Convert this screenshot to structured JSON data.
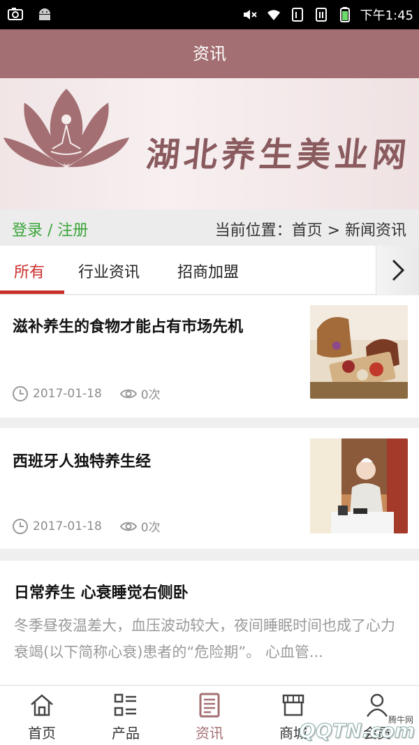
{
  "status_bar": {
    "time": "下午1:45",
    "icons": [
      "camera-icon",
      "android-icon",
      "mute-icon",
      "wifi-icon",
      "sim1-icon",
      "sim2-icon",
      "battery-icon"
    ]
  },
  "header": {
    "title": "资讯"
  },
  "banner": {
    "brand_text": "湖北养生美业网"
  },
  "breadcrumb": {
    "login_register": "登录 / 注册",
    "location": "当前位置：首页 > 新闻资讯"
  },
  "tabs": [
    {
      "label": "所有",
      "active": true
    },
    {
      "label": "行业资讯",
      "active": false
    },
    {
      "label": "招商加盟",
      "active": false
    }
  ],
  "news": [
    {
      "title": "滋补养生的食物才能占有市场先机",
      "date": "2017-01-18",
      "views": "0次"
    },
    {
      "title": "西班牙人独特养生经",
      "date": "2017-01-18",
      "views": "0次"
    },
    {
      "title": "日常养生 心衰睡觉右侧卧",
      "excerpt": "冬季昼夜温差大，血压波动较大，夜间睡眠时间也成了心力衰竭(以下简称心衰)患者的“危险期”。      心血管..."
    }
  ],
  "bottom_nav": [
    {
      "label": "首页",
      "icon": "home-icon"
    },
    {
      "label": "产品",
      "icon": "product-list-icon"
    },
    {
      "label": "资讯",
      "icon": "news-icon",
      "active": true
    },
    {
      "label": "商城",
      "icon": "store-icon"
    },
    {
      "label": "会员",
      "icon": "user-icon"
    }
  ],
  "watermark": {
    "site": "腾牛网",
    "logo": "QQTN.com"
  },
  "colors": {
    "accent": "#a46f72",
    "tab_active": "#c9302c",
    "login": "#3aa53a"
  }
}
